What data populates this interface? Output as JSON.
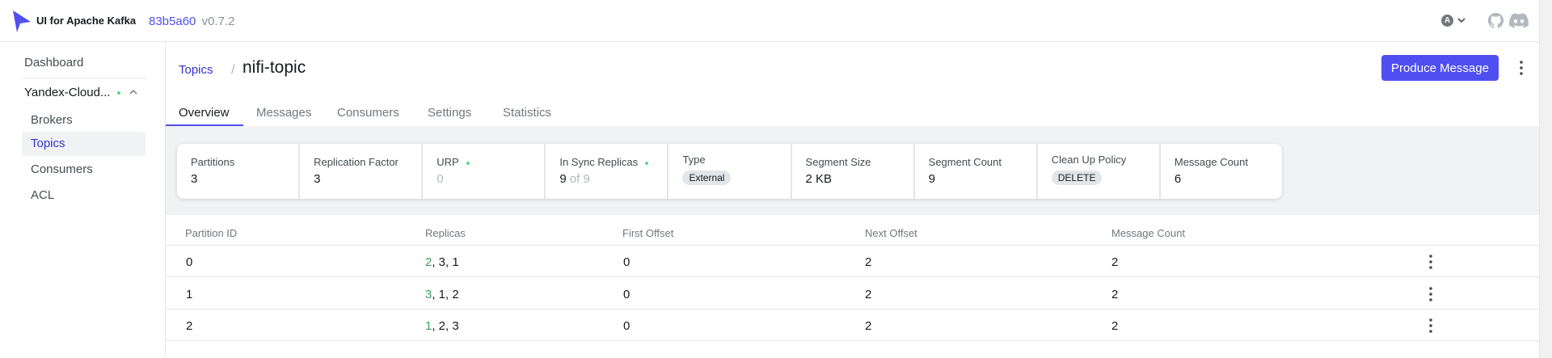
{
  "header": {
    "app_title": "UI for Apache Kafka",
    "commit": "83b5a60",
    "version": "v0.7.2",
    "avatar_letter": "A"
  },
  "sidebar": {
    "dashboard": "Dashboard",
    "cluster_name": "Yandex-Cloud...",
    "items": [
      {
        "label": "Brokers",
        "active": false
      },
      {
        "label": "Topics",
        "active": true
      },
      {
        "label": "Consumers",
        "active": false
      },
      {
        "label": "ACL",
        "active": false
      }
    ]
  },
  "breadcrumb": {
    "parent": "Topics",
    "separator": "/",
    "current": "nifi-topic"
  },
  "actions": {
    "produce_message": "Produce Message"
  },
  "tabs": [
    "Overview",
    "Messages",
    "Consumers",
    "Settings",
    "Statistics"
  ],
  "metrics": {
    "partitions": {
      "label": "Partitions",
      "value": "3"
    },
    "replication_factor": {
      "label": "Replication Factor",
      "value": "3"
    },
    "urp": {
      "label": "URP",
      "value": "0"
    },
    "in_sync_replicas": {
      "label": "In Sync Replicas",
      "value": "9",
      "of": "of 9"
    },
    "type": {
      "label": "Type",
      "value": "External"
    },
    "segment_size": {
      "label": "Segment Size",
      "value": "2 KB"
    },
    "segment_count": {
      "label": "Segment Count",
      "value": "9"
    },
    "cleanup_policy": {
      "label": "Clean Up Policy",
      "value": "DELETE"
    },
    "message_count": {
      "label": "Message Count",
      "value": "6"
    }
  },
  "table": {
    "headers": [
      "Partition ID",
      "Replicas",
      "First Offset",
      "Next Offset",
      "Message Count"
    ],
    "rows": [
      {
        "partition": "0",
        "leader": "2",
        "replicas_rest": ", 3, 1",
        "first_offset": "0",
        "next_offset": "2",
        "message_count": "2"
      },
      {
        "partition": "1",
        "leader": "3",
        "replicas_rest": ", 1, 2",
        "first_offset": "0",
        "next_offset": "2",
        "message_count": "2"
      },
      {
        "partition": "2",
        "leader": "1",
        "replicas_rest": ", 2, 3",
        "first_offset": "0",
        "next_offset": "2",
        "message_count": "2"
      }
    ]
  },
  "colors": {
    "accent": "#4f4ff0",
    "link": "#3333cc",
    "status_ok": "#5cd685",
    "leader_replica": "#3aa05c"
  }
}
